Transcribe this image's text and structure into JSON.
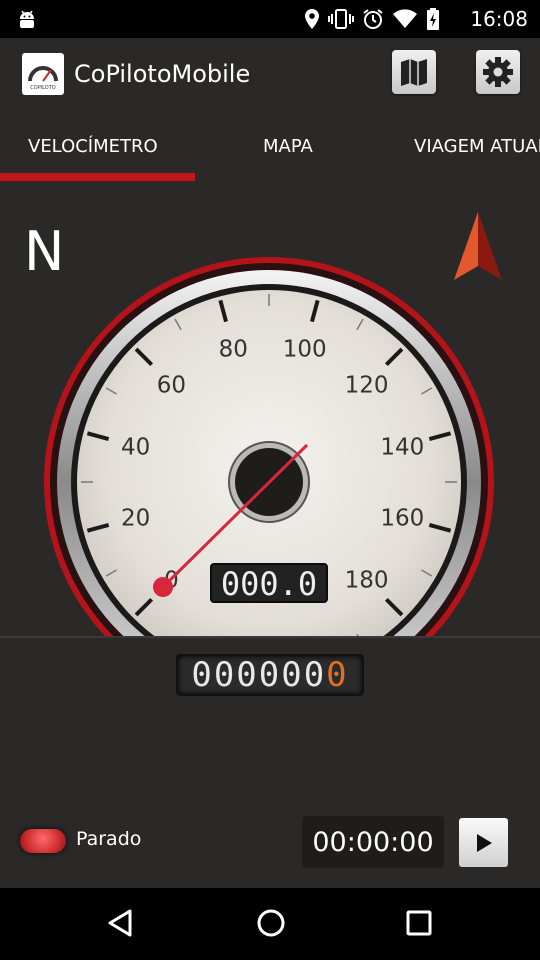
{
  "status_bar": {
    "time": "16:08",
    "icons": [
      "android-icon",
      "location-icon",
      "vibrate-icon",
      "alarm-icon",
      "wifi-icon",
      "battery-icon"
    ]
  },
  "app_bar": {
    "title": "CoPilotoMobile",
    "logo_text": "COPILOTO",
    "map_button_icon": "map-icon",
    "settings_button_icon": "gear-icon"
  },
  "tabs": [
    {
      "label": "VELOCÍMETRO",
      "selected": true
    },
    {
      "label": "MAPA",
      "selected": false
    },
    {
      "label": "VIAGEM ATUAL",
      "selected": false
    }
  ],
  "compass": {
    "heading": "N",
    "arrow_color": "#d94a2a"
  },
  "speedometer": {
    "scale_labels": [
      "0",
      "20",
      "40",
      "60",
      "80",
      "100",
      "120",
      "140",
      "160",
      "180"
    ],
    "current_speed": 0,
    "speed_display": "000.0",
    "odometer_digits": "000000",
    "odometer_last_digit": "0",
    "needle_color": "#d8263c",
    "rim_color": "#b5131a"
  },
  "status": {
    "label": "Parado",
    "indicator_color": "#d9333a"
  },
  "timer": {
    "value": "00:00:00"
  },
  "play_button_icon": "play-icon",
  "nav_bar": {
    "icons": [
      "back-icon",
      "home-icon",
      "recent-apps-icon"
    ]
  }
}
